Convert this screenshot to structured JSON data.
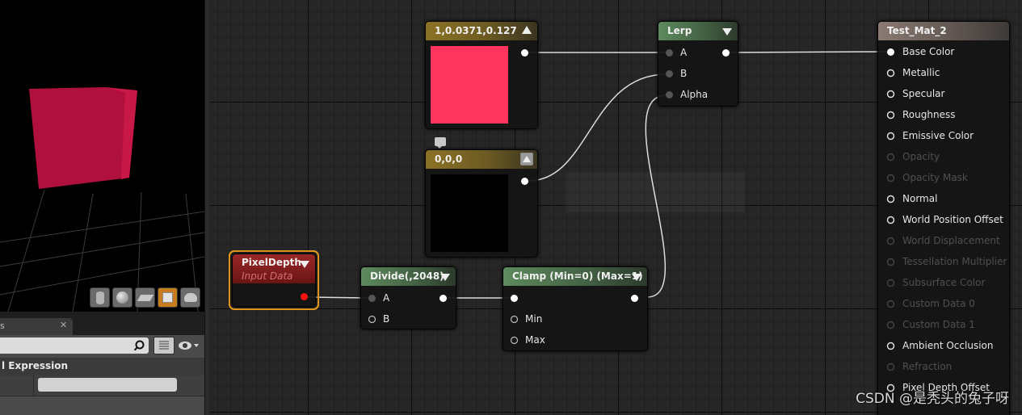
{
  "colors": {
    "base_color_swatch": "#ff3560",
    "black_swatch": "#000000",
    "selection": "#f0a020",
    "active_tool": "#c67b1f",
    "pin_live": "#ffffff",
    "pin_off": "#505050",
    "pixeldepth_pin": "#ff1010"
  },
  "viewport": {
    "toolbar_icons": [
      "cylinder-icon",
      "sphere-icon",
      "plane-icon",
      "cube-icon",
      "teapot-icon"
    ],
    "active_tool": "cube-icon"
  },
  "details": {
    "tab_label": "s",
    "tab_close": "✕",
    "search_value": "",
    "category_label": "l Expression"
  },
  "nodes": {
    "const1": {
      "title": "1,0.0371,0.127"
    },
    "const2": {
      "title": "0,0,0"
    },
    "lerp": {
      "title": "Lerp",
      "pins": [
        "A",
        "B",
        "Alpha"
      ]
    },
    "pixeldepth": {
      "title": "PixelDepth",
      "subtitle": "Input Data"
    },
    "divide": {
      "title": "Divide(,2048)",
      "pins": [
        "A",
        "B"
      ]
    },
    "clamp": {
      "title": "Clamp (Min=0) (Max=1)",
      "pins": [
        "Min",
        "Max"
      ]
    },
    "material": {
      "title": "Test_Mat_2",
      "pins": [
        {
          "label": "Base Color",
          "active": true
        },
        {
          "label": "Metallic",
          "active": true
        },
        {
          "label": "Specular",
          "active": true
        },
        {
          "label": "Roughness",
          "active": true
        },
        {
          "label": "Emissive Color",
          "active": true
        },
        {
          "label": "Opacity",
          "active": false
        },
        {
          "label": "Opacity Mask",
          "active": false
        },
        {
          "label": "Normal",
          "active": true
        },
        {
          "label": "World Position Offset",
          "active": true
        },
        {
          "label": "World Displacement",
          "active": false
        },
        {
          "label": "Tessellation Multiplier",
          "active": false
        },
        {
          "label": "Subsurface Color",
          "active": false
        },
        {
          "label": "Custom Data 0",
          "active": false
        },
        {
          "label": "Custom Data 1",
          "active": false
        },
        {
          "label": "Ambient Occlusion",
          "active": true
        },
        {
          "label": "Refraction",
          "active": false
        },
        {
          "label": "Pixel Depth Offset",
          "active": true
        }
      ]
    }
  },
  "watermark": "CSDN @是秃头的兔子呀"
}
